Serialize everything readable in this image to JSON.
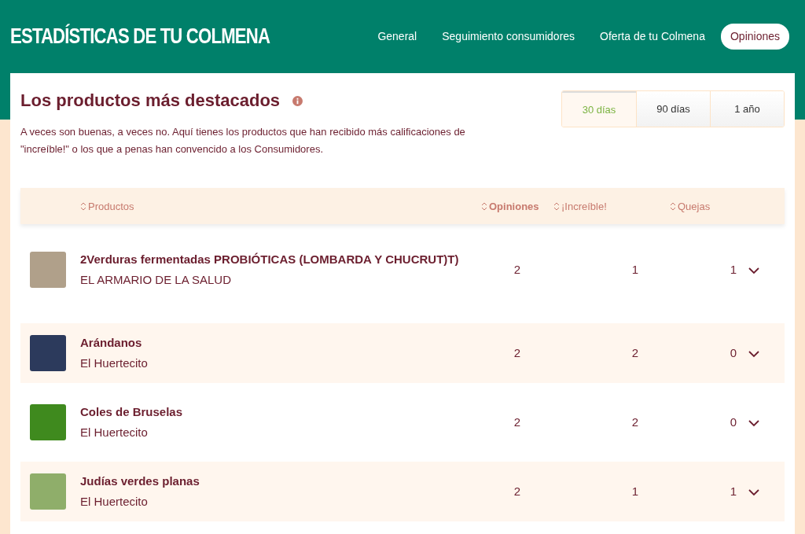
{
  "header": {
    "title": "ESTADÍSTICAS DE TU COLMENA",
    "nav": [
      {
        "label": "General",
        "selected": false
      },
      {
        "label": "Seguimiento consumidores",
        "selected": false
      },
      {
        "label": "Oferta de tu Colmena",
        "selected": false
      },
      {
        "label": "Opiniones",
        "selected": true
      }
    ]
  },
  "section": {
    "title": "Los productos más destacados",
    "description": "A veces son buenas, a veces no. Aquí tienes los productos que han recibido más calificaciones de \"increíble!\" o los que a penas han convencido a los Consumidores.",
    "periods": [
      {
        "label": "30 días",
        "selected": true
      },
      {
        "label": "90 días",
        "selected": false
      },
      {
        "label": "1 año",
        "selected": false
      }
    ]
  },
  "table": {
    "columns": [
      {
        "label": "Productos",
        "sorted": false
      },
      {
        "label": "Opiniones",
        "sorted": true
      },
      {
        "label": "¡Increíble!",
        "sorted": false
      },
      {
        "label": "Quejas",
        "sorted": false
      }
    ],
    "rows": [
      {
        "name": "2Verduras fermentadas PROBIÓTICAS (LOMBARDA Y CHUCRUT)T)",
        "producer": "EL ARMARIO DE LA SALUD",
        "opinions": "2",
        "amazing": "1",
        "complaints": "1"
      },
      {
        "name": "Arándanos",
        "producer": "El Huertecito",
        "opinions": "2",
        "amazing": "2",
        "complaints": "0"
      },
      {
        "name": "Coles de Bruselas",
        "producer": "El Huertecito",
        "opinions": "2",
        "amazing": "2",
        "complaints": "0"
      },
      {
        "name": "Judías verdes planas",
        "producer": "El Huertecito",
        "opinions": "2",
        "amazing": "1",
        "complaints": "1"
      }
    ]
  }
}
